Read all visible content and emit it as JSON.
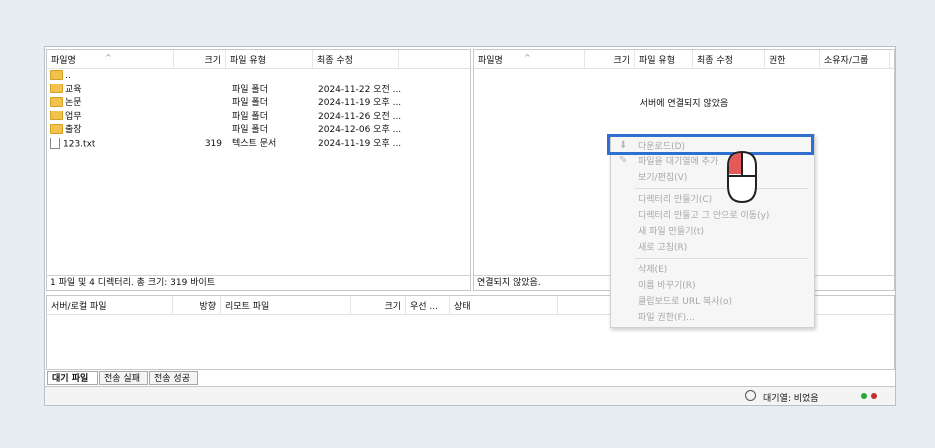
{
  "local": {
    "columns": {
      "name": "파일명",
      "size": "크기",
      "type": "파일 유형",
      "modified": "최종 수정"
    },
    "files": [
      {
        "name": "..",
        "size": "",
        "type": "",
        "modified": "",
        "icon": "folder-icon"
      },
      {
        "name": "교육",
        "size": "",
        "type": "파일 폴더",
        "modified": "2024-11-22 오전 ...",
        "icon": "folder-icon"
      },
      {
        "name": "논문",
        "size": "",
        "type": "파일 폴더",
        "modified": "2024-11-19 오후 ...",
        "icon": "folder-icon"
      },
      {
        "name": "업무",
        "size": "",
        "type": "파일 폴더",
        "modified": "2024-11-26 오전 ...",
        "icon": "folder-icon"
      },
      {
        "name": "출장",
        "size": "",
        "type": "파일 폴더",
        "modified": "2024-12-06 오후 ...",
        "icon": "folder-icon"
      },
      {
        "name": "123.txt",
        "size": "319",
        "type": "텍스트 문서",
        "modified": "2024-11-19 오후 ...",
        "icon": "file-icon"
      }
    ],
    "status": "1 파일 및 4 디렉터리. 총 크기: 319 바이트"
  },
  "remote": {
    "columns": {
      "name": "파일명",
      "size": "크기",
      "type": "파일 유형",
      "modified": "최종 수정",
      "perm": "권한",
      "owner": "소유자/그룹"
    },
    "message": "서버에 연결되지 않았음",
    "status": "연결되지 않았음."
  },
  "queue": {
    "columns": {
      "file": "서버/로컬 파일",
      "dir": "방향",
      "remote": "리모트 파일",
      "size": "크기",
      "prio": "우선 ...",
      "state": "상태"
    },
    "tabs": [
      "대기 파일",
      "전송 실패",
      "전송 성공"
    ],
    "statusbar": "대기열: 비었음"
  },
  "context_menu": {
    "items": [
      {
        "label": "다운로드(D)",
        "icon": "download-icon"
      },
      {
        "label": "파일을 대기열에 추가",
        "icon": "queue-add-icon"
      },
      {
        "label": "보기/편집(V)"
      },
      {
        "label": "디렉터리 만들기(C)"
      },
      {
        "label": "디렉터리 만들고 그 안으로 이동(y)"
      },
      {
        "label": "새 파일 만들기(t)"
      },
      {
        "label": "새로 고침(R)"
      },
      {
        "label": "삭제(E)"
      },
      {
        "label": "이름 바꾸기(R)"
      },
      {
        "label": "클립보드로 URL 복사(o)"
      },
      {
        "label": "파일 권한(F)..."
      }
    ]
  },
  "colors": {
    "highlight": "#2f6fd0",
    "folder": "#f2c14e",
    "green_led": "#27a935",
    "red_led": "#c0302c",
    "cursor_button": "#e45a5a"
  }
}
